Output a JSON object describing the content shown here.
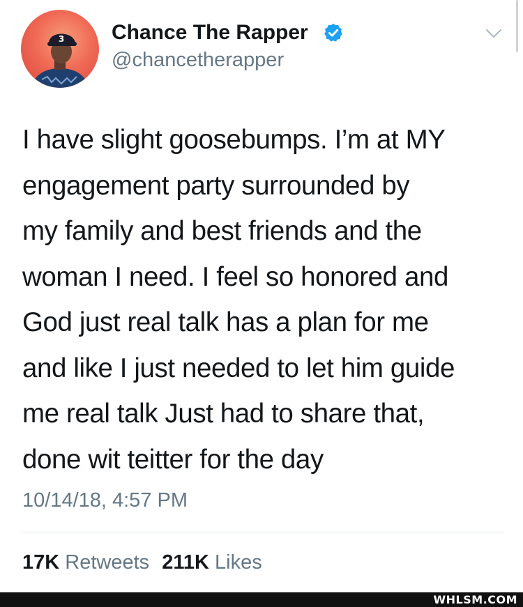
{
  "user": {
    "display_name": "Chance The Rapper",
    "handle": "@chancetherapper",
    "verified": true,
    "avatar_icon": "avatar-person-with-number-3-cap",
    "cap_number": "3"
  },
  "tweet": {
    "lines": [
      "I have slight goosebumps. I’m at MY",
      "engagement party surrounded by",
      "my family and best friends and the",
      "woman I need. I feel so honored and",
      "God just real talk has a plan for me",
      "and like I just needed to let him guide",
      "me real talk Just had to share that,",
      "done wit teitter for the day"
    ],
    "timestamp": "10/14/18, 4:57 PM"
  },
  "stats": {
    "retweets_count": "17K",
    "retweets_label": "Retweets",
    "likes_count": "211K",
    "likes_label": "Likes"
  },
  "watermark": "WHLSM.COM",
  "colors": {
    "verified_blue": "#1da1f2",
    "text_primary": "#14171a",
    "text_secondary": "#657786",
    "avatar_bg": "#f06a55"
  },
  "icons": {
    "verified": "verified-badge-icon",
    "menu": "chevron-down-icon"
  }
}
